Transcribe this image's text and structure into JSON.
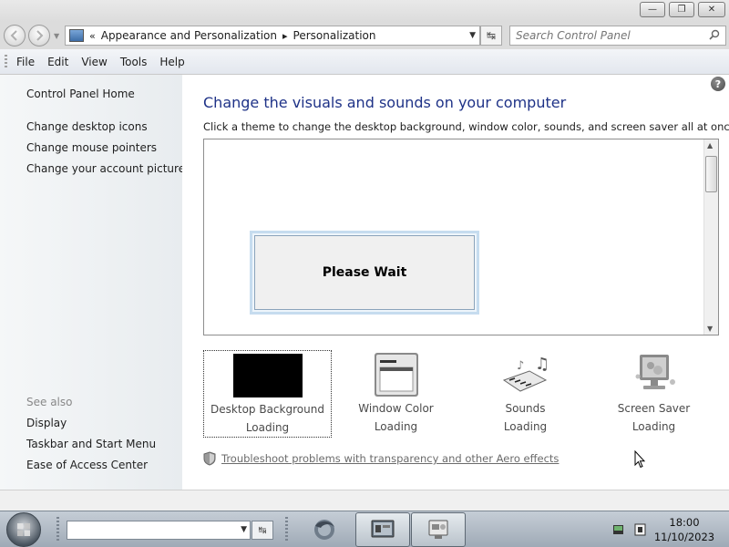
{
  "titlebar": {
    "minimize": "—",
    "maximize": "❐",
    "close": "✕"
  },
  "address": {
    "prefix": "«",
    "breadcrumb": [
      "Appearance and Personalization",
      "Personalization"
    ],
    "separator": "▸",
    "refresh": "↹",
    "search_placeholder": "Search Control Panel"
  },
  "menu": {
    "items": [
      "File",
      "Edit",
      "View",
      "Tools",
      "Help"
    ]
  },
  "sidebar": {
    "home": "Control Panel Home",
    "tasks": [
      "Change desktop icons",
      "Change mouse pointers",
      "Change your account picture"
    ],
    "see_also_heading": "See also",
    "see_also": [
      "Display",
      "Taskbar and Start Menu",
      "Ease of Access Center"
    ]
  },
  "main": {
    "help": "?",
    "heading": "Change the visuals and sounds on your computer",
    "subheading": "Click a theme to change the desktop background, window color, sounds, and screen saver all at once.",
    "wait_text": "Please Wait",
    "settings": [
      {
        "label": "Desktop Background",
        "status": "Loading",
        "icon": "desktop-background-icon"
      },
      {
        "label": "Window Color",
        "status": "Loading",
        "icon": "window-color-icon"
      },
      {
        "label": "Sounds",
        "status": "Loading",
        "icon": "sounds-icon"
      },
      {
        "label": "Screen Saver",
        "status": "Loading",
        "icon": "screen-saver-icon"
      }
    ],
    "troubleshoot_link": "Troubleshoot problems with transparency and other Aero effects"
  },
  "taskbar": {
    "time": "18:00",
    "date": "11/10/2023",
    "address_value": ""
  }
}
